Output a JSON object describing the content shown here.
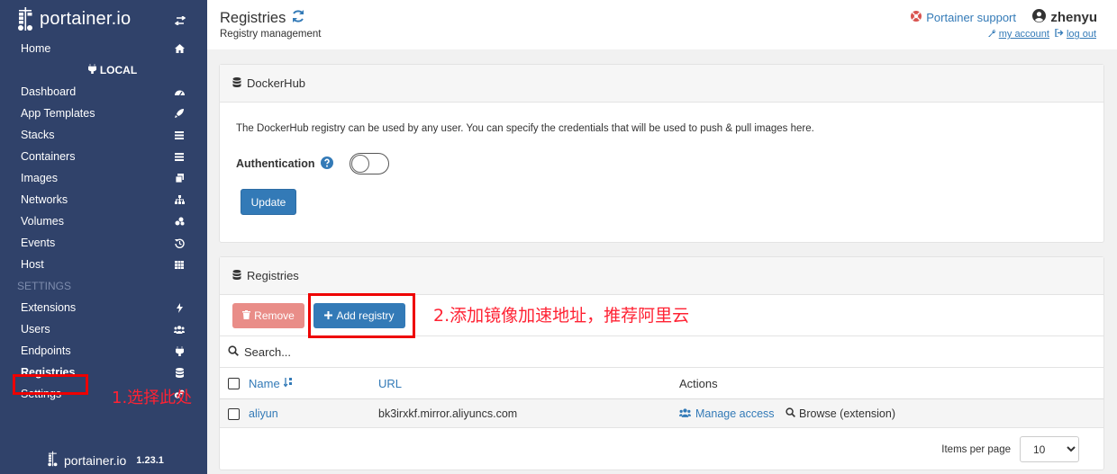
{
  "sidebar": {
    "brand": "portainer.io",
    "home": "Home",
    "endpoint_header": "LOCAL",
    "items": [
      {
        "label": "Dashboard"
      },
      {
        "label": "App Templates"
      },
      {
        "label": "Stacks"
      },
      {
        "label": "Containers"
      },
      {
        "label": "Images"
      },
      {
        "label": "Networks"
      },
      {
        "label": "Volumes"
      },
      {
        "label": "Events"
      },
      {
        "label": "Host"
      }
    ],
    "settings_header": "SETTINGS",
    "settings_items": [
      {
        "label": "Extensions"
      },
      {
        "label": "Users"
      },
      {
        "label": "Endpoints"
      },
      {
        "label": "Registries"
      },
      {
        "label": "Settings"
      }
    ],
    "footer_brand": "portainer.io",
    "version": "1.23.1"
  },
  "header": {
    "title": "Registries",
    "subtitle": "Registry management",
    "support": "Portainer support",
    "username": "zhenyu",
    "my_account": "my account",
    "log_out": "log out"
  },
  "dockerhub": {
    "title": "DockerHub",
    "description": "The DockerHub registry can be used by any user. You can specify the credentials that will be used to push & pull images here.",
    "auth_label": "Authentication",
    "auth_enabled": false,
    "update_label": "Update"
  },
  "registries": {
    "title": "Registries",
    "remove_label": "Remove",
    "add_label": "Add registry",
    "search_placeholder": "Search...",
    "columns": {
      "name": "Name",
      "url": "URL",
      "actions": "Actions"
    },
    "rows": [
      {
        "name": "aliyun",
        "url": "bk3irxkf.mirror.aliyuncs.com",
        "manage": "Manage access",
        "browse": "Browse (extension)"
      }
    ],
    "items_per_page_label": "Items per page",
    "items_per_page": "10"
  },
  "annotations": {
    "step1": "1.选择此处",
    "step2": "2.添加镜像加速地址，推荐阿里云"
  },
  "colors": {
    "sidebar_bg": "#30426a",
    "primary": "#337ab7",
    "danger_light": "#e98d88",
    "annotation_red": "#ff2233"
  }
}
